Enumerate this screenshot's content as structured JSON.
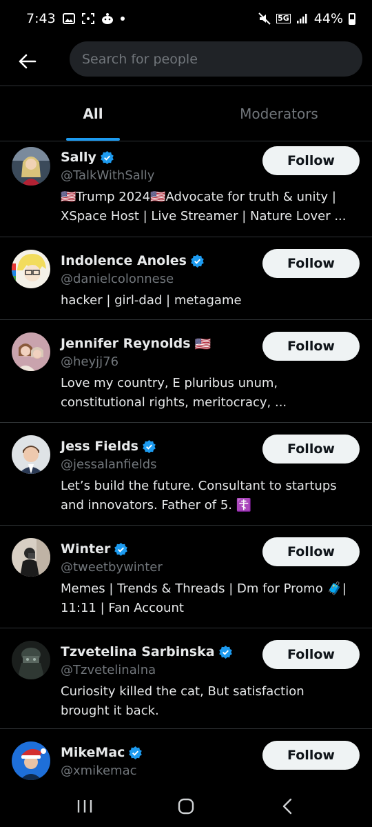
{
  "status_bar": {
    "time": "7:43",
    "network": "5G",
    "battery": "44%"
  },
  "search": {
    "placeholder": "Search for people"
  },
  "tabs": [
    {
      "label": "All",
      "active": true
    },
    {
      "label": "Moderators",
      "active": false
    }
  ],
  "users": [
    {
      "name": "Sally",
      "verified": true,
      "flag": "",
      "handle": "@TalkWithSally",
      "bio": "🇺🇸Trump 2024🇺🇸Advocate for truth & unity | XSpace Host | Live Streamer |  Nature Lover ...",
      "follow": "Follow"
    },
    {
      "name": "Indolence Anoles",
      "verified": true,
      "flag": "",
      "handle": "@danielcolonnese",
      "bio": "hacker | girl-dad | metagame",
      "follow": "Follow"
    },
    {
      "name": "Jennifer Reynolds",
      "verified": false,
      "flag": "🇺🇸",
      "handle": "@heyjj76",
      "bio": "Love my country, E pluribus unum, constitutional rights, meritocracy, ...",
      "follow": "Follow"
    },
    {
      "name": "Jess Fields",
      "verified": true,
      "flag": "",
      "handle": "@jessalanfields",
      "bio": "Let’s build the future. Consultant to startups and innovators. Father of 5. ☦️",
      "follow": "Follow"
    },
    {
      "name": "Winter",
      "verified": true,
      "flag": "",
      "handle": "@tweetbywinter",
      "bio": "Memes | Trends & Threads | Dm for Promo  🧳| 11:11 | Fan Account",
      "follow": "Follow"
    },
    {
      "name": "Tzvetelina Sarbinska",
      "verified": true,
      "flag": "",
      "handle": "@Tzvetelinalna",
      "bio": "Curiosity killed the cat, But satisfaction brought it back.",
      "follow": "Follow"
    },
    {
      "name": "MikeMac",
      "verified": true,
      "flag": "",
      "handle": "@xmikemac",
      "bio": "",
      "follow": "Follow"
    }
  ],
  "colors": {
    "background": "#000000",
    "accent": "#1d9bf0",
    "secondary_text": "#71767b",
    "button_bg": "#eff3f4"
  }
}
